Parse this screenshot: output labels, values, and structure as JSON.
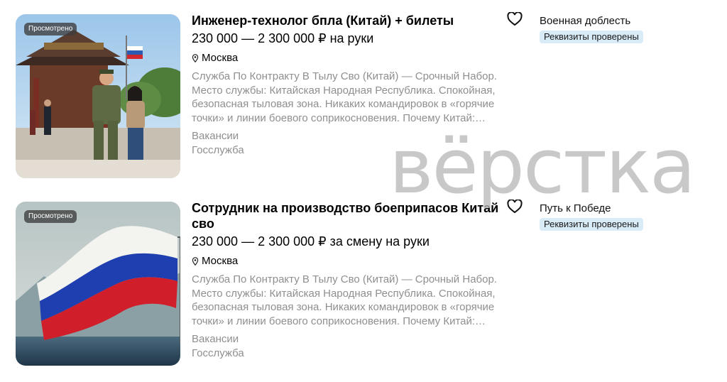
{
  "listings": [
    {
      "badge": "Просмотрено",
      "title": "Инженер-технолог бпла (Китай) + билеты",
      "price": "230 000 — 2 300 000 ₽ на руки",
      "location": "Москва",
      "description": "Служба По Контракту В Тылу Сво (Китай) — Срочный Набор. Место службы: Китайская Народная Республика. Спокойная, безопасная тыловая зона. Никаких командировок в «горячие точки» и линии боевого соприкосновения. Почему Китай:…",
      "categories": [
        "Вакансии",
        "Госслужба"
      ],
      "seller": "Военная доблесть",
      "verified": "Реквизиты проверены",
      "image_icon": "soldier-photo"
    },
    {
      "badge": "Просмотрено",
      "title": "Сотрудник на производство боеприпасов Китай сво",
      "price": "230 000 — 2 300 000 ₽ за смену на руки",
      "location": "Москва",
      "description": "Служба По Контракту В Тылу Сво (Китай) — Срочный Набор. Место службы: Китайская Народная Республика. Спокойная, безопасная тыловая зона. Никаких командировок в «горячие точки» и линии боевого соприкосновения. Почему Китай:…",
      "categories": [
        "Вакансии",
        "Госслужба"
      ],
      "seller": "Путь к Победе",
      "verified": "Реквизиты проверены",
      "image_icon": "russian-flag-photo"
    }
  ],
  "watermark": "вёрстка",
  "colors": {
    "muted_text": "#8f8f8f",
    "verified_bg": "#d9ebf7",
    "badge_bg": "#3c3c3c"
  }
}
